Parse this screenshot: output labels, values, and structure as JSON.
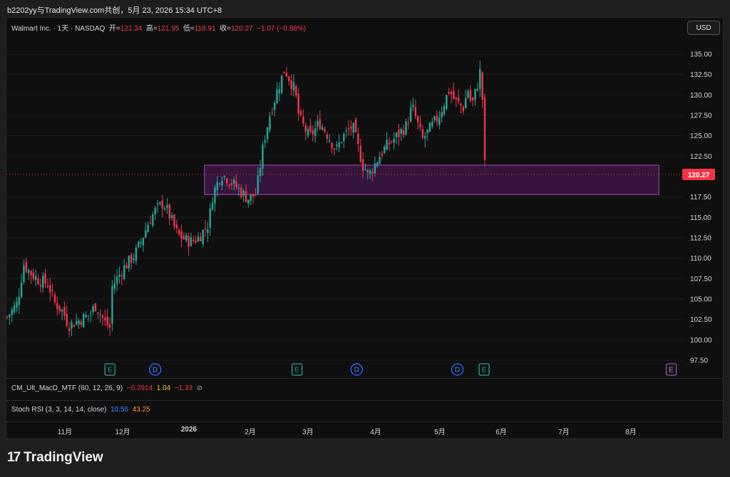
{
  "header": {
    "caption": "b2202yy与TradingView.com共创，5月 23, 2026 15:34 UTC+8"
  },
  "legend": {
    "title": "Walmart Inc. · 1天 · NASDAQ",
    "open_label": "开=",
    "open": "121.34",
    "high_label": "高=",
    "high": "121.95",
    "low_label": "低=",
    "low": "118.91",
    "close_label": "收=",
    "close": "120.27",
    "change": "−1.07 (−0.88%)"
  },
  "currency_button": "USD",
  "indicators": {
    "macd": {
      "name": "CM_Ult_MacD_MTF (60, 12, 26, 9)",
      "v1": "−0.2914",
      "v2": "1.04",
      "v3": "−1.33",
      "icon": "hidden-eye-icon"
    },
    "stoch": {
      "name": "Stoch RSI (3, 3, 14, 14, close)",
      "k": "10.56",
      "d": "43.25"
    }
  },
  "x_axis_labels": [
    "11月",
    "12月",
    "2026",
    "2月",
    "3月",
    "4月",
    "5月",
    "6月",
    "7月",
    "8月"
  ],
  "price_badge": "120.27",
  "brand": "TradingView",
  "colors": {
    "up": "#26a69a",
    "down": "#f23645",
    "zone": "#9c27b0",
    "price_line": "#f23645"
  },
  "chart_data": {
    "type": "candlestick",
    "symbol": "Walmart Inc.",
    "interval": "1天",
    "exchange": "NASDAQ",
    "y_ticks": [
      "135.00",
      "132.50",
      "130.00",
      "127.50",
      "125.00",
      "122.50",
      "117.50",
      "115.00",
      "112.50",
      "110.00",
      "107.50",
      "105.00",
      "102.50",
      "100.00",
      "97.50"
    ],
    "ylim": [
      97.5,
      135.0
    ],
    "last_price": 120.27,
    "zone": {
      "from": "2026-01-05",
      "to": "2026-08-14",
      "low": 117.8,
      "high": 121.4
    },
    "events": [
      {
        "type": "earnings",
        "label": "E",
        "date": "2025-11-20"
      },
      {
        "type": "dividend",
        "label": "D",
        "date": "2025-12-12"
      },
      {
        "type": "earnings",
        "label": "E",
        "date": "2026-02-19"
      },
      {
        "type": "dividend",
        "label": "D",
        "date": "2026-03-20"
      },
      {
        "type": "dividend",
        "label": "D",
        "date": "2026-05-08"
      },
      {
        "type": "earnings",
        "label": "E",
        "date": "2026-05-21"
      },
      {
        "type": "earnings_future",
        "label": "E",
        "date": "2026-08-20"
      }
    ],
    "close_path": [
      {
        "d": "2025-10-01",
        "c": 102.8
      },
      {
        "d": "2025-10-06",
        "c": 104.5
      },
      {
        "d": "2025-10-09",
        "c": 109.3
      },
      {
        "d": "2025-10-13",
        "c": 108.0
      },
      {
        "d": "2025-10-16",
        "c": 107.4
      },
      {
        "d": "2025-10-21",
        "c": 106.8
      },
      {
        "d": "2025-10-24",
        "c": 104.6
      },
      {
        "d": "2025-10-28",
        "c": 103.5
      },
      {
        "d": "2025-10-31",
        "c": 101.8
      },
      {
        "d": "2025-11-05",
        "c": 102.4
      },
      {
        "d": "2025-11-10",
        "c": 103.1
      },
      {
        "d": "2025-11-13",
        "c": 104.2
      },
      {
        "d": "2025-11-18",
        "c": 102.0
      },
      {
        "d": "2025-11-20",
        "c": 101.5
      },
      {
        "d": "2025-11-21",
        "c": 106.5
      },
      {
        "d": "2025-11-26",
        "c": 108.6
      },
      {
        "d": "2025-12-02",
        "c": 110.4
      },
      {
        "d": "2025-12-05",
        "c": 112.0
      },
      {
        "d": "2025-12-09",
        "c": 114.5
      },
      {
        "d": "2025-12-12",
        "c": 115.8
      },
      {
        "d": "2025-12-16",
        "c": 116.8
      },
      {
        "d": "2025-12-19",
        "c": 115.2
      },
      {
        "d": "2025-12-23",
        "c": 112.8
      },
      {
        "d": "2025-12-29",
        "c": 112.0
      },
      {
        "d": "2026-01-02",
        "c": 112.5
      },
      {
        "d": "2026-01-07",
        "c": 114.2
      },
      {
        "d": "2026-01-09",
        "c": 117.8
      },
      {
        "d": "2026-01-13",
        "c": 120.3
      },
      {
        "d": "2026-01-16",
        "c": 119.8
      },
      {
        "d": "2026-01-21",
        "c": 118.6
      },
      {
        "d": "2026-01-26",
        "c": 117.3
      },
      {
        "d": "2026-01-30",
        "c": 117.8
      },
      {
        "d": "2026-02-03",
        "c": 124.5
      },
      {
        "d": "2026-02-06",
        "c": 127.8
      },
      {
        "d": "2026-02-10",
        "c": 131.0
      },
      {
        "d": "2026-02-13",
        "c": 133.2
      },
      {
        "d": "2026-02-18",
        "c": 130.5
      },
      {
        "d": "2026-02-20",
        "c": 127.2
      },
      {
        "d": "2026-02-25",
        "c": 124.8
      },
      {
        "d": "2026-03-02",
        "c": 126.6
      },
      {
        "d": "2026-03-05",
        "c": 125.5
      },
      {
        "d": "2026-03-10",
        "c": 123.2
      },
      {
        "d": "2026-03-13",
        "c": 124.8
      },
      {
        "d": "2026-03-18",
        "c": 126.2
      },
      {
        "d": "2026-03-23",
        "c": 121.4
      },
      {
        "d": "2026-03-26",
        "c": 120.2
      },
      {
        "d": "2026-03-31",
        "c": 122.5
      },
      {
        "d": "2026-04-03",
        "c": 123.6
      },
      {
        "d": "2026-04-08",
        "c": 124.8
      },
      {
        "d": "2026-04-13",
        "c": 126.2
      },
      {
        "d": "2026-04-16",
        "c": 128.6
      },
      {
        "d": "2026-04-21",
        "c": 124.5
      },
      {
        "d": "2026-04-24",
        "c": 125.6
      },
      {
        "d": "2026-04-29",
        "c": 127.4
      },
      {
        "d": "2026-05-04",
        "c": 130.6
      },
      {
        "d": "2026-05-07",
        "c": 129.2
      },
      {
        "d": "2026-05-11",
        "c": 128.4
      },
      {
        "d": "2026-05-13",
        "c": 130.8
      },
      {
        "d": "2026-05-15",
        "c": 128.6
      },
      {
        "d": "2026-05-18",
        "c": 131.5
      },
      {
        "d": "2026-05-19",
        "c": 132.8
      },
      {
        "d": "2026-05-20",
        "c": 130.8
      },
      {
        "d": "2026-05-21",
        "c": 122.0
      },
      {
        "d": "2026-05-22",
        "c": 120.27
      }
    ]
  }
}
